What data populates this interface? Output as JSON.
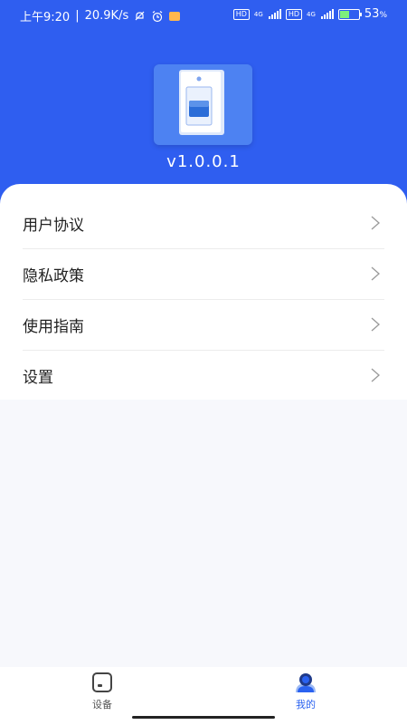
{
  "status_bar": {
    "time": "上午9:20",
    "speed": "20.9K/s",
    "hd_label": "HD",
    "network_label": "4G",
    "battery": "53",
    "battery_unit": "%",
    "battery_level": 0.53
  },
  "app": {
    "version": "v1.0.0.1"
  },
  "menu": {
    "items": [
      {
        "label": "用户协议"
      },
      {
        "label": "隐私政策"
      },
      {
        "label": "使用指南"
      },
      {
        "label": "设置"
      }
    ]
  },
  "tabbar": {
    "tabs": [
      {
        "label": "设备",
        "color": "#555555"
      },
      {
        "label": "我的",
        "color": "#2a62f0"
      }
    ],
    "active_index": 1
  }
}
